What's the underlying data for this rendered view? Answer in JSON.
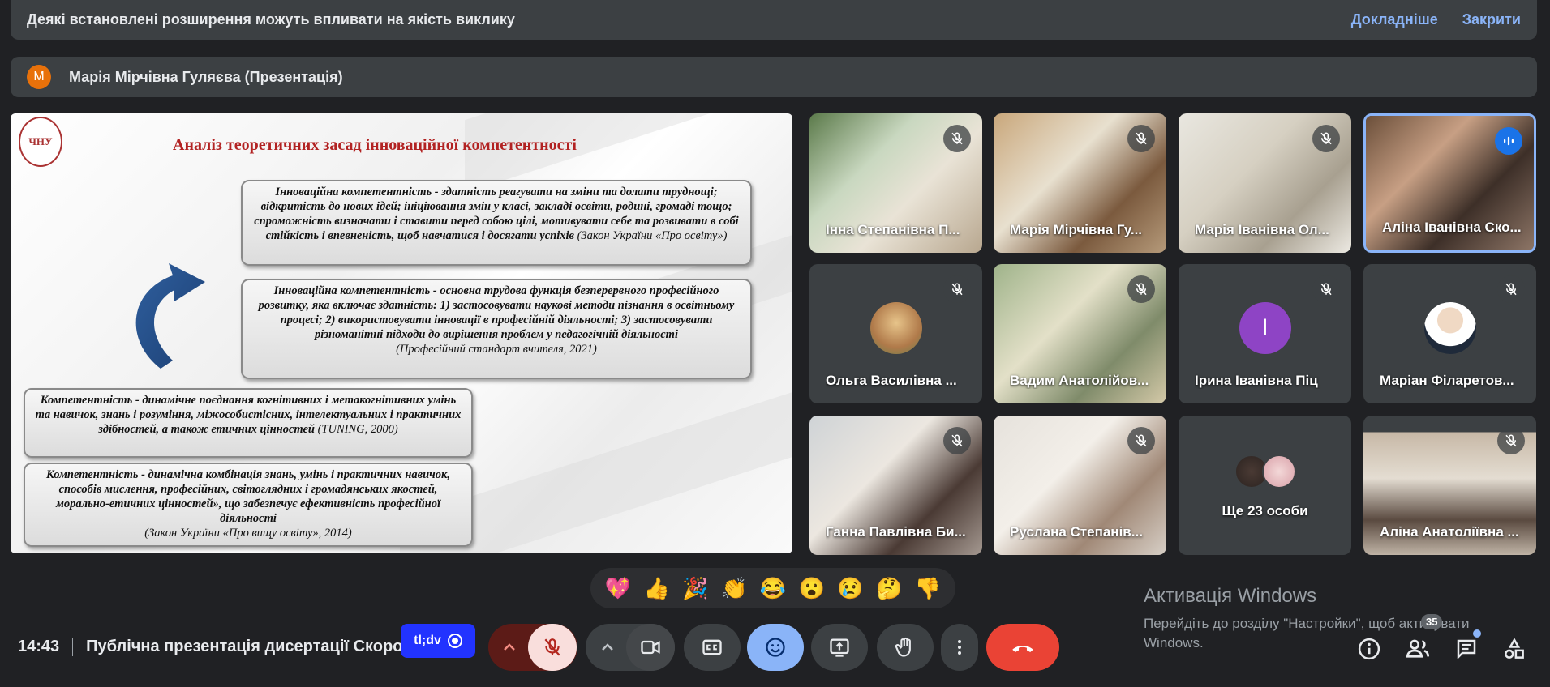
{
  "banner": {
    "message": "Деякі встановлені розширення можуть впливати на якість виклику",
    "learn_more": "Докладніше",
    "close": "Закрити"
  },
  "presenter": {
    "initial": "M",
    "name": "Марія Мірчівна Гуляєва (Презентація)"
  },
  "slide": {
    "logo_text": "ЧНУ",
    "title": "Аналіз теоретичних засад інноваційної компетентності",
    "box1": {
      "text": "Інноваційна компетентність - здатність реагувати на зміни та долати труднощі; відкритість до нових ідей; ініціювання змін у класі, закладі освіти, родині, громаді тощо; спроможність визначати і ставити перед собою цілі, мотивувати себе та розвивати в собі стійкість і впевненість, щоб навчатися і досягати успіхів",
      "source": " (Закон України «Про освіту»)"
    },
    "box2": {
      "text": "Інноваційна компетентність - основна трудова функція безперервного професійного розвитку, яка включає здатність: 1) застосовувати наукові методи пізнання в освітньому процесі; 2) використовувати інновації в професійній діяльності; 3) застосовувати різноманітні підходи до вирішення проблем у педагогічній діяльності",
      "source": "(Професійний стандарт вчителя, 2021)"
    },
    "box3": {
      "text": "Компетентність - динамічне поєднання когнітивних і метакогнітивних умінь та навичок, знань і розуміння, міжособистісних, інтелектуальних і практичних здібностей, а також етичних цінностей",
      "source": " (TUNING, 2000)"
    },
    "box4": {
      "text": "Компетентність - динамічна комбінація знань, умінь і практичних навичок, способів мислення, професійних, світоглядних і громадянських якостей, морально-етичних цінностей», що забезпечує ефективність професійної діяльності",
      "source": "(Закон України «Про вищу освіту», 2014)"
    }
  },
  "participants": [
    {
      "name": "Інна Степанівна П...",
      "type": "video",
      "muted": true
    },
    {
      "name": "Марія Мірчівна Гу...",
      "type": "video",
      "muted": true
    },
    {
      "name": "Марія Іванівна Ол...",
      "type": "video",
      "muted": true
    },
    {
      "name": "Аліна Іванівна Ско...",
      "type": "video",
      "muted": false
    },
    {
      "name": "Ольга Василівна ...",
      "type": "avatar",
      "muted": true
    },
    {
      "name": "Вадим Анатолійов...",
      "type": "video",
      "muted": true
    },
    {
      "name": "Ірина Іванівна Піц",
      "type": "letter",
      "initial": "I",
      "muted": true
    },
    {
      "name": "Маріан Філаретов...",
      "type": "avatar",
      "muted": true
    },
    {
      "name": "Ганна Павлівна Би...",
      "type": "video",
      "muted": true
    },
    {
      "name": "Руслана Степанів...",
      "type": "video",
      "muted": true
    },
    {
      "name": "Ще 23 особи",
      "type": "more",
      "muted": false
    },
    {
      "name": "Аліна Анатоліївна ...",
      "type": "video",
      "muted": true
    }
  ],
  "reactions": [
    "💖",
    "👍",
    "🎉",
    "👏",
    "😂",
    "😮",
    "😢",
    "🤔",
    "👎"
  ],
  "footer": {
    "time": "14:43",
    "meeting_title": "Публічна презентація дисертації Скоролі",
    "tldv_label": "tl;dv",
    "participant_count": "35"
  },
  "activation": {
    "heading": "Активація Windows",
    "subtext": "Перейдіть до розділу \"Настройки\", щоб активувати Windows."
  },
  "colors": {
    "background": "#202124",
    "surface": "#3c4043",
    "accent": "#8ab4f8",
    "end_call": "#ea4335",
    "mic_off": "#f9dedc"
  }
}
